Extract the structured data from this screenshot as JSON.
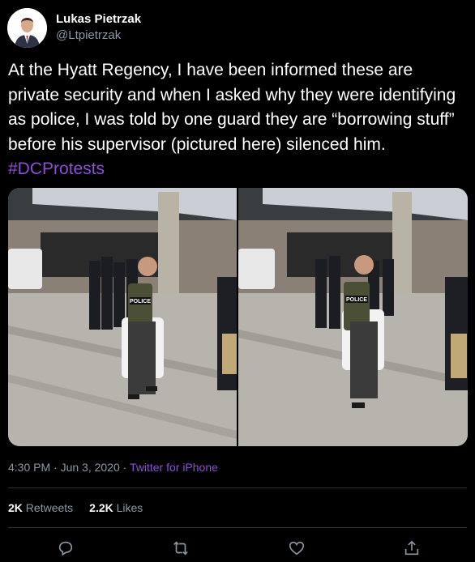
{
  "author": {
    "display_name": "Lukas Pietrzak",
    "handle": "@Ltpietrzak"
  },
  "tweet": {
    "text": "At the Hyatt Regency, I have been informed these are private security and when I asked why they were identifying as police, I was told by one guard they are “borrowing stuff” before his supervisor (pictured here) silenced him.",
    "hashtag": "#DCProtests"
  },
  "media": {
    "vest_label": "POLICE"
  },
  "meta": {
    "time": "4:30 PM",
    "separator": "·",
    "date": "Jun 3, 2020",
    "source": "Twitter for iPhone"
  },
  "stats": {
    "retweets_count": "2K",
    "retweets_label": "Retweets",
    "likes_count": "2.2K",
    "likes_label": "Likes"
  },
  "colors": {
    "background": "#000000",
    "text": "#ffffff",
    "muted": "#8b98a5",
    "accent": "#8b4fd6",
    "divider": "#2f3336"
  },
  "icons": [
    "reply-icon",
    "retweet-icon",
    "like-icon",
    "share-icon"
  ]
}
